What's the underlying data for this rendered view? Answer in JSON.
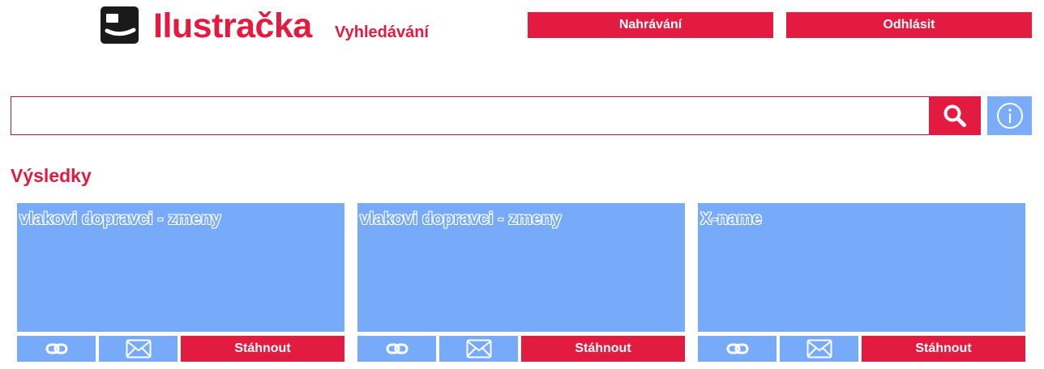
{
  "brand": {
    "name": "Ilustračka",
    "section": "Vyhledávání"
  },
  "header": {
    "upload_label": "Nahrávání",
    "logout_label": "Odhlásit"
  },
  "search": {
    "value": "",
    "placeholder": ""
  },
  "results": {
    "title": "Výsledky",
    "items": [
      {
        "title": "vlakovi dopravci - zmeny",
        "download_label": "Stáhnout"
      },
      {
        "title": "vlakovi dopravci - zmeny",
        "download_label": "Stáhnout"
      },
      {
        "title": "X-name",
        "download_label": "Stáhnout"
      }
    ]
  },
  "colors": {
    "accent": "#e31b40",
    "secondary": "#77aaf9",
    "logo_dark": "#1a1a1a"
  },
  "icons": {
    "search": "search-icon",
    "info": "info-icon",
    "link": "link-icon",
    "mail": "mail-icon"
  }
}
